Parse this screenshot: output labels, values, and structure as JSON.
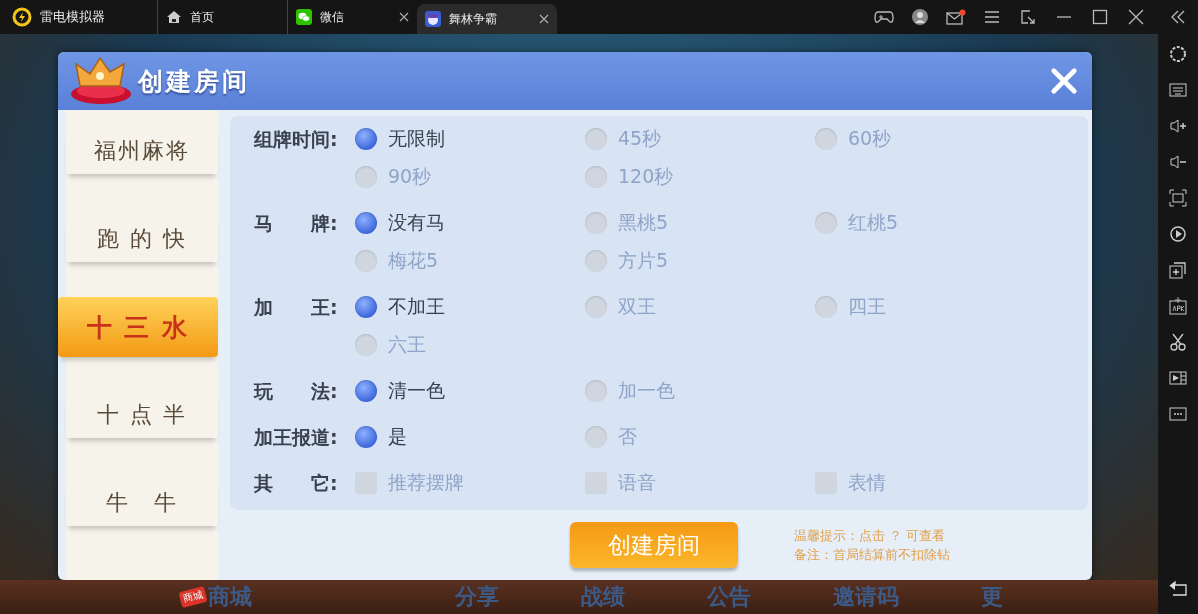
{
  "emulator": {
    "title": "雷电模拟器",
    "tabs": [
      {
        "label": "首页",
        "selected": false,
        "closable": false
      },
      {
        "label": "微信",
        "selected": false,
        "closable": true
      },
      {
        "label": "舞林争霸",
        "selected": true,
        "closable": true
      }
    ]
  },
  "dialog": {
    "title": "创建房间",
    "games": [
      {
        "label": "福州麻将",
        "selected": false
      },
      {
        "label": "跑 的 快",
        "selected": false
      },
      {
        "label": "十 三 水",
        "selected": true
      },
      {
        "label": "十 点 半",
        "selected": false
      },
      {
        "label": "牛　牛",
        "selected": false
      }
    ],
    "groups": [
      {
        "label": "组牌时间:",
        "kind": "radio",
        "options": [
          {
            "label": "无限制",
            "selected": true
          },
          {
            "label": "45秒",
            "selected": false
          },
          {
            "label": "60秒",
            "selected": false
          },
          {
            "label": "90秒",
            "selected": false
          },
          {
            "label": "120秒",
            "selected": false
          }
        ]
      },
      {
        "label": "马　　牌:",
        "kind": "radio",
        "options": [
          {
            "label": "没有马",
            "selected": true
          },
          {
            "label": "黑桃5",
            "selected": false
          },
          {
            "label": "红桃5",
            "selected": false
          },
          {
            "label": "梅花5",
            "selected": false
          },
          {
            "label": "方片5",
            "selected": false
          }
        ]
      },
      {
        "label": "加　　王:",
        "kind": "radio",
        "options": [
          {
            "label": "不加王",
            "selected": true
          },
          {
            "label": "双王",
            "selected": false
          },
          {
            "label": "四王",
            "selected": false
          },
          {
            "label": "六王",
            "selected": false
          }
        ]
      },
      {
        "label": "玩　　法:",
        "kind": "radio",
        "options": [
          {
            "label": "清一色",
            "selected": true
          },
          {
            "label": "加一色",
            "selected": false
          }
        ]
      },
      {
        "label": "加王报道:",
        "kind": "radio",
        "options": [
          {
            "label": "是",
            "selected": true
          },
          {
            "label": "否",
            "selected": false
          }
        ]
      },
      {
        "label": "其　　它:",
        "kind": "checkbox",
        "options": [
          {
            "label": "推荐摆牌",
            "selected": false
          },
          {
            "label": "语音",
            "selected": false
          },
          {
            "label": "表情",
            "selected": false
          }
        ]
      }
    ],
    "create_button": "创建房间",
    "hints": [
      "温馨提示：点击 ？ 可查看",
      "备注：首局结算前不扣除钻"
    ]
  },
  "game_menu": {
    "badge": "商城",
    "items": [
      "商城",
      "分享",
      "战绩",
      "公告",
      "邀请码",
      "更"
    ]
  }
}
